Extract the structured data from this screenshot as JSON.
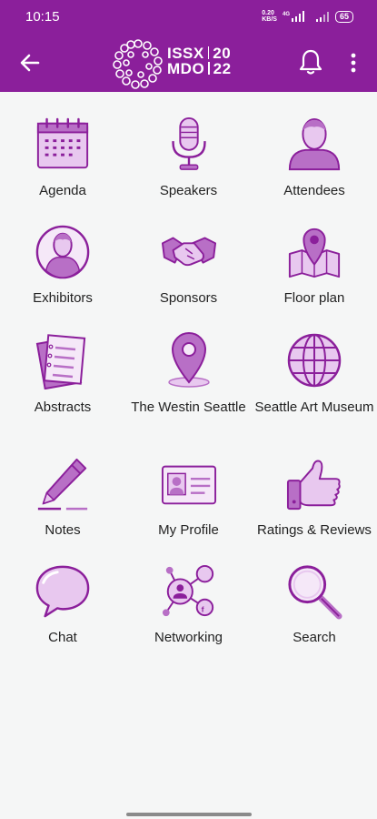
{
  "status": {
    "time": "10:15",
    "net_speed_top": "0.20",
    "net_speed_unit": "KB/S",
    "battery": "65"
  },
  "header": {
    "logo_line1": "ISSX",
    "logo_line2": "MDO",
    "logo_year1": "20",
    "logo_year2": "22",
    "brand_color": "#8b1f9b"
  },
  "tiles": [
    {
      "label": "Agenda",
      "icon": "calendar-icon"
    },
    {
      "label": "Speakers",
      "icon": "microphone-icon"
    },
    {
      "label": "Attendees",
      "icon": "person-icon"
    },
    {
      "label": "Exhibitors",
      "icon": "user-circle-icon"
    },
    {
      "label": "Sponsors",
      "icon": "handshake-icon"
    },
    {
      "label": "Floor plan",
      "icon": "map-pin-icon"
    },
    {
      "label": "Abstracts",
      "icon": "documents-icon"
    },
    {
      "label": "The Westin Seattle",
      "icon": "location-pin-icon"
    },
    {
      "label": "Seattle Art Museum",
      "icon": "globe-icon"
    },
    {
      "label": "Notes",
      "icon": "pen-icon"
    },
    {
      "label": "My Profile",
      "icon": "id-card-icon"
    },
    {
      "label": "Ratings & Reviews",
      "icon": "thumbs-up-icon"
    },
    {
      "label": "Chat",
      "icon": "speech-bubble-icon"
    },
    {
      "label": "Networking",
      "icon": "network-icon"
    },
    {
      "label": "Search",
      "icon": "magnifier-icon"
    }
  ]
}
